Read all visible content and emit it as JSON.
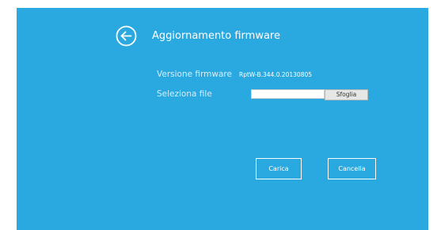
{
  "page": {
    "title": "Aggiornamento firmware",
    "back_icon": "circle-arrow-left-icon",
    "background_color": "#29a9e0"
  },
  "form": {
    "firmware_version_label": "Versione firmware",
    "firmware_version_value": "RptW-B.344.0.20130805",
    "select_file_label": "Seleziona file",
    "file_input_value": "",
    "browse_label": "Sfoglia"
  },
  "actions": {
    "upload_label": "Carica",
    "cancel_label": "Cancella"
  }
}
